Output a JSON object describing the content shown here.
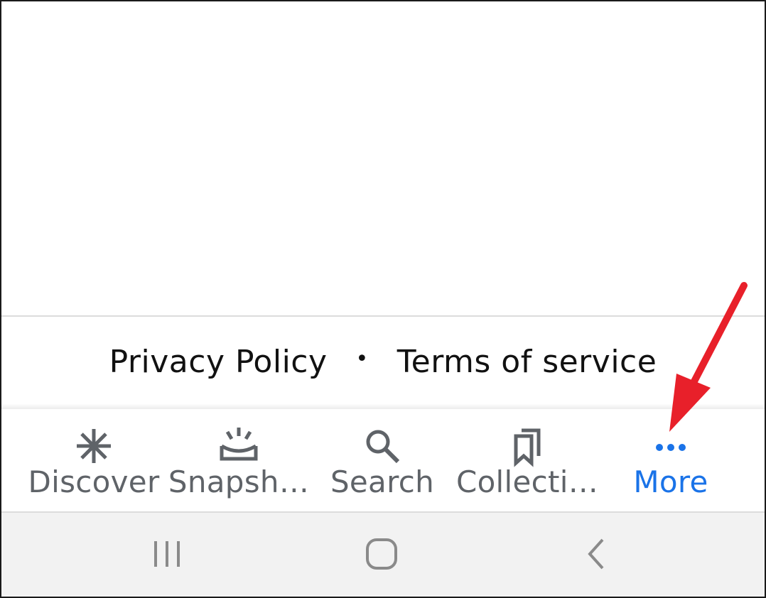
{
  "footer": {
    "privacy_label": "Privacy Policy",
    "separator": "•",
    "terms_label": "Terms of service"
  },
  "bottom_nav": {
    "items": [
      {
        "label": "Discover",
        "icon": "asterisk-icon",
        "active": false
      },
      {
        "label": "Snapsh…",
        "icon": "snapshot-icon",
        "active": false
      },
      {
        "label": "Search",
        "icon": "search-icon",
        "active": false
      },
      {
        "label": "Collecti…",
        "icon": "collections-icon",
        "active": false
      },
      {
        "label": "More",
        "icon": "more-dots-icon",
        "active": true
      }
    ]
  },
  "system_nav": {
    "buttons": [
      "recent-apps-icon",
      "home-icon",
      "back-icon"
    ]
  },
  "colors": {
    "active": "#1a73e8",
    "inactive": "#5f6368",
    "annotation_arrow": "#e8202a"
  }
}
